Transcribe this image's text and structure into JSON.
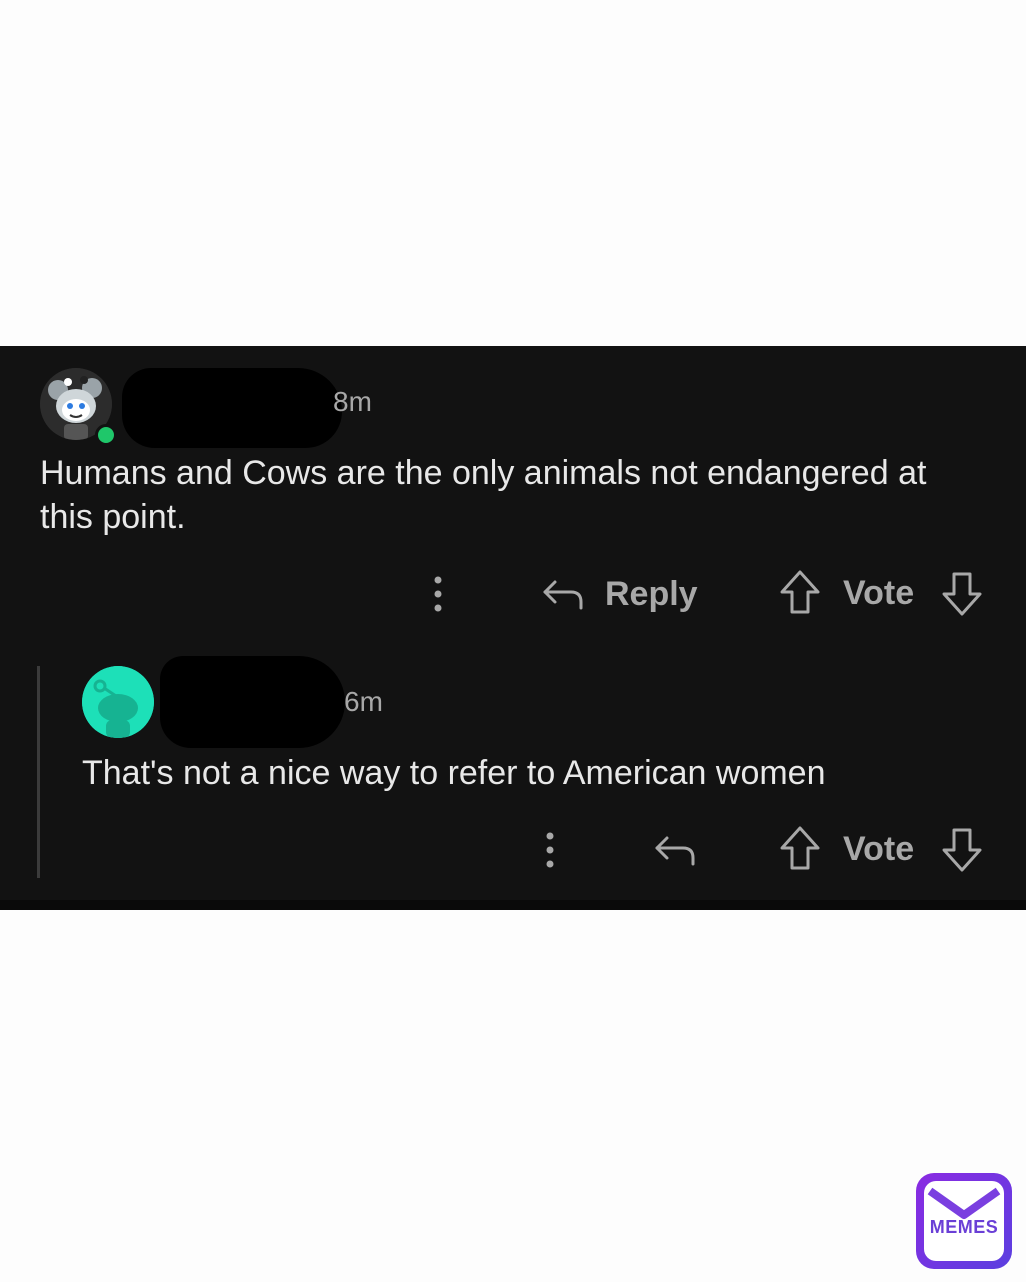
{
  "comments": [
    {
      "timestamp": "8m",
      "text": "Humans and Cows are the only animals not endangered at this point.",
      "reply_label": "Reply",
      "vote_label": "Vote"
    },
    {
      "timestamp": "6m",
      "text": "That's not a nice way to refer to American women",
      "vote_label": "Vote"
    }
  ],
  "watermark": {
    "text": "MEMES"
  },
  "colors": {
    "background": "#121212",
    "text": "#e8e8e8",
    "muted": "#a8a8a8",
    "online": "#1fc76a",
    "avatar2": "#1de0b8"
  }
}
